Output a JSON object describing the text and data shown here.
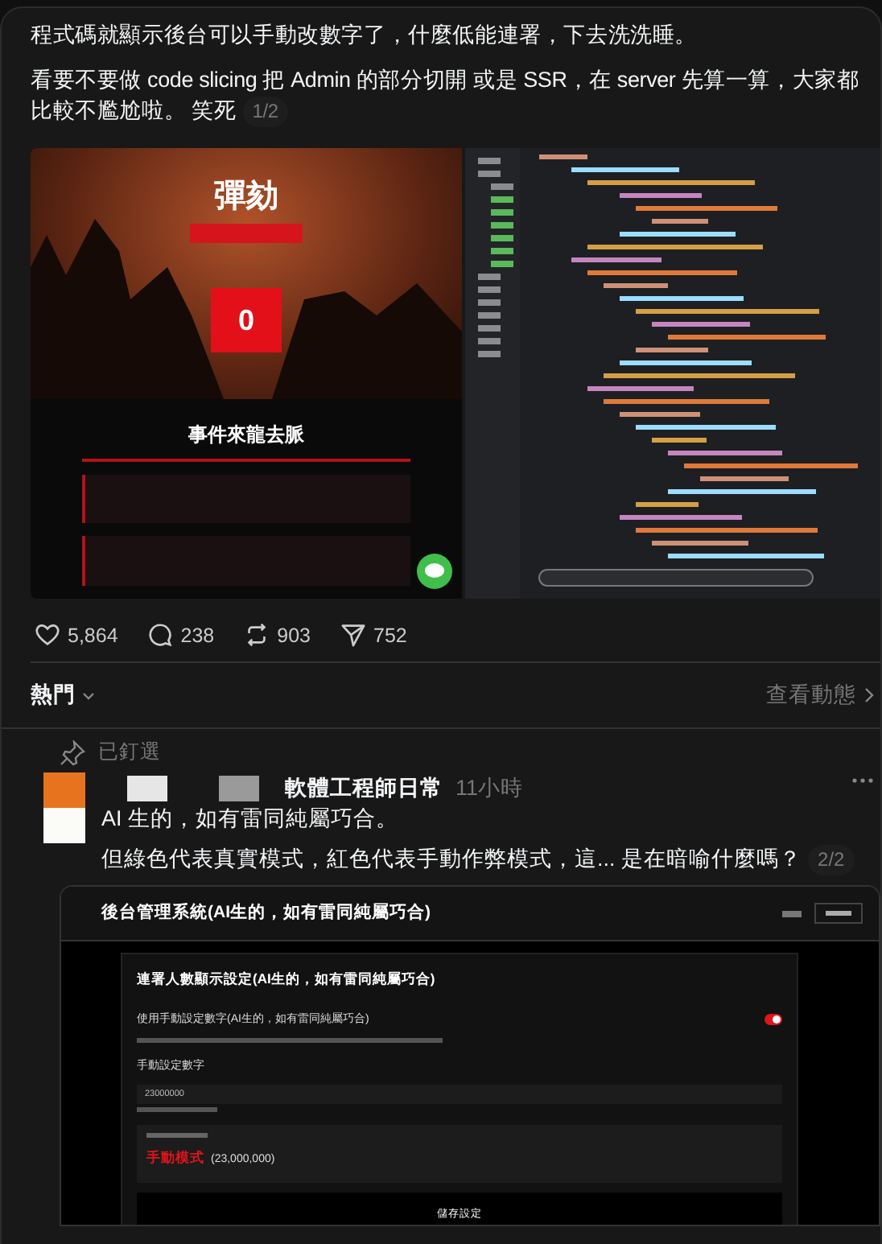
{
  "post": {
    "paragraphs": [
      "程式碼就顯示後台可以手動改數字了，什麼低能連署，下去洗洗睡。",
      "看要不要做 code slicing 把 Admin 的部分切開 或是 SSR，在 server 先算一算，大家都比較不尷尬啦。 笑死"
    ],
    "counter": "1/2"
  },
  "media": [
    {
      "kind": "site",
      "title": "彈劾",
      "counter_value": "0",
      "section_title": "事件來龍去脈"
    },
    {
      "kind": "editor"
    }
  ],
  "actions": [
    {
      "kind": "like",
      "count": "5,864"
    },
    {
      "kind": "reply",
      "count": "238"
    },
    {
      "kind": "repost",
      "count": "903"
    },
    {
      "kind": "share",
      "count": "752"
    }
  ],
  "sort": {
    "label": "熱門",
    "link": "查看動態"
  },
  "reply": {
    "pinned_label": "已釘選",
    "author": "軟體工程師日常",
    "time": "11小時",
    "paragraphs": [
      "AI 生的，如有雷同純屬巧合。",
      "但綠色代表真實模式，紅色代表手動作弊模式，這... 是在暗喻什麼嗎？"
    ],
    "counter": "2/2",
    "screenshot": {
      "title": "後台管理系統(AI生的，如有雷同純屬巧合)",
      "card_title": "連署人數顯示設定(AI生的，如有雷同純屬巧合)",
      "toggle_label": "使用手動設定數字(AI生的，如有雷同純屬巧合)",
      "toggle_on": true,
      "field_label": "手動設定數字",
      "field_value": "23000000",
      "mode_value": "手動模式",
      "mode_count": "(23,000,000)",
      "save_button": "儲存設定"
    }
  }
}
